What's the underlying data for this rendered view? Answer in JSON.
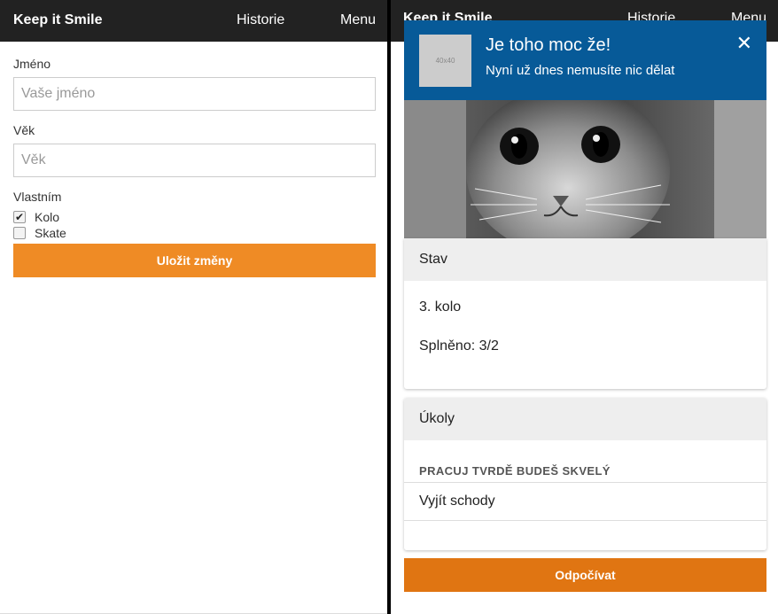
{
  "left": {
    "navbar": {
      "brand": "Keep it Smile",
      "history": "Historie",
      "menu": "Menu"
    },
    "form": {
      "name_label": "Jméno",
      "name_placeholder": "Vaše jméno",
      "age_label": "Věk",
      "age_placeholder": "Věk",
      "owned_label": "Vlastním",
      "items": [
        {
          "label": "Kolo",
          "checked": true
        },
        {
          "label": "Skate",
          "checked": false
        }
      ],
      "save_label": "Uložit změny"
    }
  },
  "right": {
    "navbar": {
      "brand": "Keep it Smile",
      "history": "Historie",
      "menu": "Menu"
    },
    "notification": {
      "title": "Je toho moc že!",
      "text": "Nyní už dnes nemusíte nic dělat",
      "thumb_label": "40x40",
      "close_icon": "close-icon"
    },
    "status": {
      "header": "Stav",
      "round": "3. kolo",
      "done": "Splněno: 3/2"
    },
    "tasks": {
      "header": "Úkoly",
      "section": "PRACUJ TVRDĚ BUDEŠ SKVELÝ",
      "items": [
        "Vyjít schody",
        ""
      ]
    },
    "rest_label": "Odpočívat"
  },
  "colors": {
    "navbar": "#222222",
    "accent": "#ef8b25",
    "notification": "#075a98"
  }
}
